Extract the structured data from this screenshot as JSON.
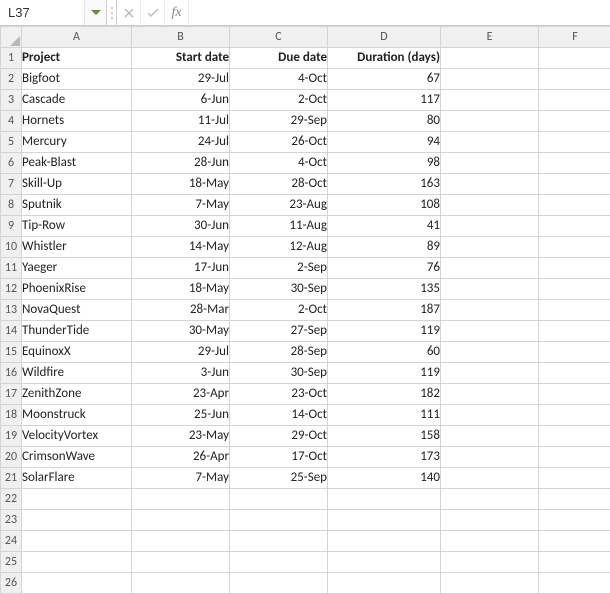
{
  "formula_bar": {
    "cell_ref": "L37",
    "formula_value": ""
  },
  "columns": [
    "A",
    "B",
    "C",
    "D",
    "E",
    "F"
  ],
  "row_count": 26,
  "headers": {
    "project": "Project",
    "start": "Start date",
    "due": "Due date",
    "duration": "Duration (days)"
  },
  "rows": [
    {
      "project": "Bigfoot",
      "start": "29-Jul",
      "due": "4-Oct",
      "duration": 67
    },
    {
      "project": "Cascade",
      "start": "6-Jun",
      "due": "2-Oct",
      "duration": 117
    },
    {
      "project": "Hornets",
      "start": "11-Jul",
      "due": "29-Sep",
      "duration": 80
    },
    {
      "project": "Mercury",
      "start": "24-Jul",
      "due": "26-Oct",
      "duration": 94
    },
    {
      "project": "Peak-Blast",
      "start": "28-Jun",
      "due": "4-Oct",
      "duration": 98
    },
    {
      "project": "Skill-Up",
      "start": "18-May",
      "due": "28-Oct",
      "duration": 163
    },
    {
      "project": "Sputnik",
      "start": "7-May",
      "due": "23-Aug",
      "duration": 108
    },
    {
      "project": "Tip-Row",
      "start": "30-Jun",
      "due": "11-Aug",
      "duration": 41
    },
    {
      "project": "Whistler",
      "start": "14-May",
      "due": "12-Aug",
      "duration": 89
    },
    {
      "project": "Yaeger",
      "start": "17-Jun",
      "due": "2-Sep",
      "duration": 76
    },
    {
      "project": "PhoenixRise",
      "start": "18-May",
      "due": "30-Sep",
      "duration": 135
    },
    {
      "project": "NovaQuest",
      "start": "28-Mar",
      "due": "2-Oct",
      "duration": 187
    },
    {
      "project": "ThunderTide",
      "start": "30-May",
      "due": "27-Sep",
      "duration": 119
    },
    {
      "project": "EquinoxX",
      "start": "29-Jul",
      "due": "28-Sep",
      "duration": 60
    },
    {
      "project": "Wildfire",
      "start": "3-Jun",
      "due": "30-Sep",
      "duration": 119
    },
    {
      "project": "ZenithZone",
      "start": "23-Apr",
      "due": "23-Oct",
      "duration": 182
    },
    {
      "project": "Moonstruck",
      "start": "25-Jun",
      "due": "14-Oct",
      "duration": 111
    },
    {
      "project": "VelocityVortex",
      "start": "23-May",
      "due": "29-Oct",
      "duration": 158
    },
    {
      "project": "CrimsonWave",
      "start": "26-Apr",
      "due": "17-Oct",
      "duration": 173
    },
    {
      "project": "SolarFlare",
      "start": "7-May",
      "due": "25-Sep",
      "duration": 140
    }
  ]
}
